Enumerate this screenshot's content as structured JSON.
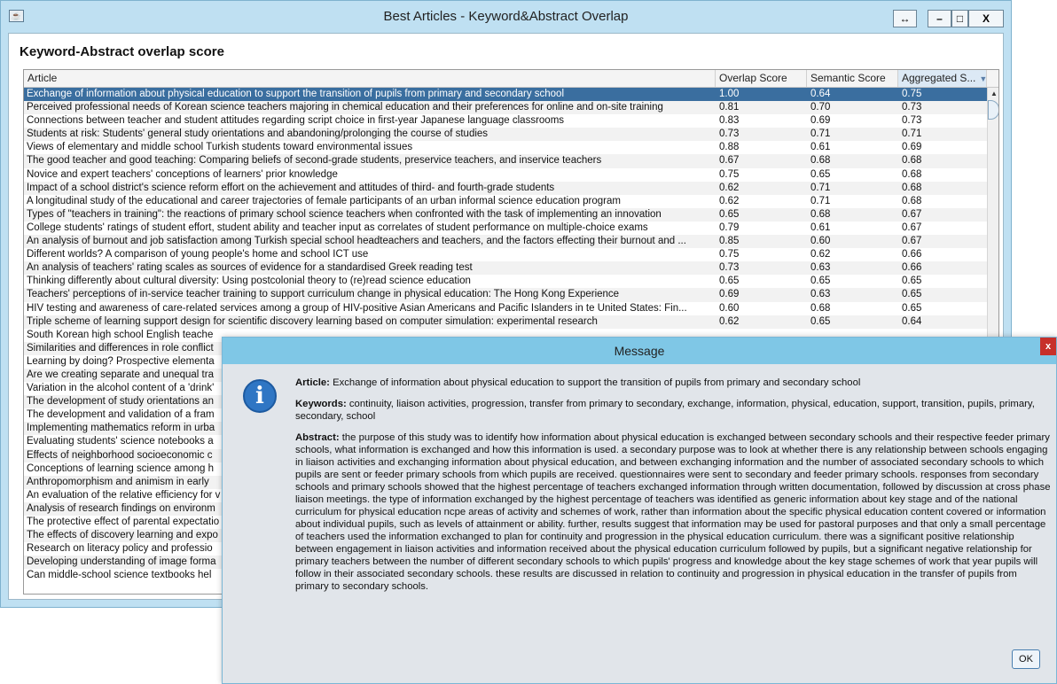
{
  "window": {
    "title": "Best Articles - Keyword&Abstract Overlap",
    "controls": {
      "resize": "↔",
      "minimize": "–",
      "maximize": "□",
      "close": "X"
    }
  },
  "heading": "Keyword-Abstract overlap score",
  "table": {
    "columns": [
      "Article",
      "Overlap Score",
      "Semantic Score",
      "Aggregated S..."
    ],
    "sort_indicator": "▼",
    "rows": [
      [
        "Exchange of information about physical education to support the transition of pupils from primary and secondary school",
        "1.00",
        "0.64",
        "0.75"
      ],
      [
        "Perceived professional needs of Korean science teachers majoring in chemical education and their preferences for online and on-site training",
        "0.81",
        "0.70",
        "0.73"
      ],
      [
        "Connections between teacher and student attitudes regarding script choice in first-year Japanese language classrooms",
        "0.83",
        "0.69",
        "0.73"
      ],
      [
        "Students at risk: Students' general study orientations and abandoning/prolonging the course of studies",
        "0.73",
        "0.71",
        "0.71"
      ],
      [
        "Views of elementary and middle school Turkish students toward environmental issues",
        "0.88",
        "0.61",
        "0.69"
      ],
      [
        "The good teacher and good teaching: Comparing beliefs of second-grade students, preservice teachers, and inservice teachers",
        "0.67",
        "0.68",
        "0.68"
      ],
      [
        "Novice and expert teachers' conceptions of learners' prior knowledge",
        "0.75",
        "0.65",
        "0.68"
      ],
      [
        "Impact of a school district's science reform effort on the achievement and attitudes of third- and fourth-grade students",
        "0.62",
        "0.71",
        "0.68"
      ],
      [
        "A longitudinal study of the educational and career trajectories of female participants of an urban informal science education program",
        "0.62",
        "0.71",
        "0.68"
      ],
      [
        "Types of \"teachers in training\": the reactions of primary school science teachers when confronted with the task of implementing an innovation",
        "0.65",
        "0.68",
        "0.67"
      ],
      [
        "College students' ratings of student effort, student ability and teacher input as correlates of student performance on multiple-choice exams",
        "0.79",
        "0.61",
        "0.67"
      ],
      [
        "An analysis of burnout and job satisfaction among Turkish special school headteachers and teachers, and the factors effecting their burnout and ...",
        "0.85",
        "0.60",
        "0.67"
      ],
      [
        "Different worlds? A comparison of young people's home and school ICT use",
        "0.75",
        "0.62",
        "0.66"
      ],
      [
        "An analysis of teachers' rating scales as sources of evidence for a standardised Greek reading test",
        "0.73",
        "0.63",
        "0.66"
      ],
      [
        "Thinking differently about cultural diversity: Using postcolonial theory to (re)read science education",
        "0.65",
        "0.65",
        "0.65"
      ],
      [
        "Teachers' perceptions of in-service teacher training to support curriculum change in physical education: The Hong Kong Experience",
        "0.69",
        "0.63",
        "0.65"
      ],
      [
        "HIV testing and awareness of care-related services among a group of HIV-positive Asian Americans and Pacific Islanders in te United States: Fin...",
        "0.60",
        "0.68",
        "0.65"
      ],
      [
        "Triple scheme of learning support design for scientific discovery learning based on computer simulation: experimental research",
        "0.62",
        "0.65",
        "0.64"
      ],
      [
        "South Korean high school English teache",
        "",
        "",
        ""
      ],
      [
        "Similarities and differences in role conflict",
        "",
        "",
        ""
      ],
      [
        "Learning by doing? Prospective elementa",
        "",
        "",
        ""
      ],
      [
        "Are we creating separate and unequal tra",
        "",
        "",
        ""
      ],
      [
        "Variation in the alcohol content of a 'drink'",
        "",
        "",
        ""
      ],
      [
        "The development of study orientations an",
        "",
        "",
        ""
      ],
      [
        "The development and validation of a fram",
        "",
        "",
        ""
      ],
      [
        "Implementing mathematics reform in urba",
        "",
        "",
        ""
      ],
      [
        "Evaluating students' science notebooks a",
        "",
        "",
        ""
      ],
      [
        "Effects of neighborhood socioeconomic c",
        "",
        "",
        ""
      ],
      [
        "Conceptions of learning science among h",
        "",
        "",
        ""
      ],
      [
        "Anthropomorphism and animism in early",
        "",
        "",
        ""
      ],
      [
        "An evaluation of the relative efficiency for v",
        "",
        "",
        ""
      ],
      [
        "Analysis of research findings on environm",
        "",
        "",
        ""
      ],
      [
        "The protective effect of parental expectatio",
        "",
        "",
        ""
      ],
      [
        "The effects of discovery learning and expo",
        "",
        "",
        ""
      ],
      [
        "Research on literacy policy and professio",
        "",
        "",
        ""
      ],
      [
        "Developing understanding of image forma",
        "",
        "",
        ""
      ],
      [
        "Can middle-school science textbooks hel",
        "",
        "",
        ""
      ]
    ]
  },
  "dialog": {
    "title": "Message",
    "close": "x",
    "icon": "i",
    "article_label": "Article:",
    "article": "Exchange of information about physical education to support the transition of pupils from primary and secondary school",
    "keywords_label": "Keywords:",
    "keywords": "continuity, liaison activities, progression, transfer from primary to secondary, exchange, information, physical, education, support, transition, pupils, primary, secondary, school",
    "abstract_label": "Abstract:",
    "abstract": "the purpose of this study was to identify how information about physical education is exchanged between secondary schools and their respective feeder primary schools, what information is exchanged and how this information is used. a secondary purpose was to look at whether there is any relationship between schools engaging in liaison activities and exchanging information about physical education, and between exchanging information and the number of associated secondary schools to which pupils are sent or feeder primary schools from which pupils are received. questionnaires were sent to secondary and feeder primary schools. responses from secondary schools and primary schools showed that the highest percentage of teachers exchanged information through written documentation, followed by discussion at cross phase liaison meetings. the type of information exchanged by the highest percentage of teachers was identified as generic information about key stage and of the national curriculum for physical education ncpe areas of activity and schemes of work, rather than information about the specific physical education content covered or information about individual pupils, such as levels of attainment or ability. further, results suggest that information may be used for pastoral purposes and that only a small percentage of teachers used the information exchanged to plan for continuity and progression in the physical education curriculum. there was a significant positive relationship between engagement in liaison activities and information received about the physical education curriculum followed by pupils, but a significant negative relationship for primary teachers between the number of different secondary schools to which pupils' progress and knowledge about the key stage schemes of work that year pupils will follow in their associated secondary schools. these results are discussed in relation to continuity and progression in physical education in the transfer of pupils from primary to secondary schools.",
    "ok_label": "OK"
  },
  "colors": {
    "selected_row": "#3a6e9f",
    "dialog_titlebar": "#7fc7e6",
    "close_red": "#c7302a",
    "info_icon_blue": "#2f76c4"
  }
}
